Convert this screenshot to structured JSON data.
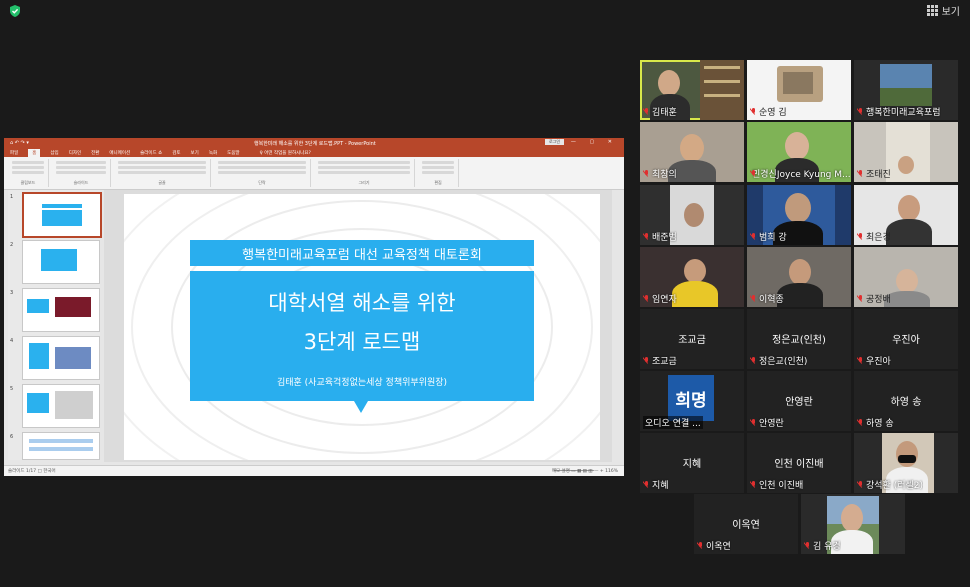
{
  "topbar": {
    "view_label": "보기",
    "security": "shield-icon"
  },
  "ppt": {
    "doc_title": "행복한미래 해소를 위한 3단계 로드맵.PPT - PowerPoint",
    "quick_access": "⌂ ↶ ↷ ▾",
    "signin": "로그인",
    "window_controls": "— ▢ ✕",
    "tabs": [
      "파일",
      "홈",
      "삽입",
      "디자인",
      "전환",
      "애니메이션",
      "슬라이드 쇼",
      "검토",
      "보기",
      "녹화",
      "도움말"
    ],
    "tell_me": "♀ 어떤 작업을 원하시나요?",
    "ribbon_groups": [
      "클립보드",
      "슬라이드",
      "글꼴",
      "단락",
      "그리기",
      "편집"
    ],
    "slide_numbers": [
      "1",
      "2",
      "3",
      "4",
      "5",
      "6"
    ],
    "status_left": "슬라이드 1/17   □   한국어",
    "status_right": "메모   설명   ▭ ▦ ▤ ▥  —  +  116%",
    "slide": {
      "banner_title": "행복한미래교육포럼 대선 교육정책 대토론회",
      "title_line1": "대학서열 해소를 위한",
      "title_line2": "3단계 로드맵",
      "author": "김태훈 (사교육걱정없는세상 정책위부위원장)"
    }
  },
  "participants": [
    {
      "name": "김태훈",
      "video": true,
      "active": true
    },
    {
      "name": "순영 김",
      "video": true
    },
    {
      "name": "행복한미래교육포럼",
      "video": true
    },
    {
      "name": "최창의",
      "video": true
    },
    {
      "name": "민경신Joyce Kyung M...",
      "video": true
    },
    {
      "name": "조태진",
      "video": true
    },
    {
      "name": "배준범",
      "video": true
    },
    {
      "name": "범희 강",
      "video": true
    },
    {
      "name": "최은경",
      "video": true
    },
    {
      "name": "임연자",
      "video": true
    },
    {
      "name": "이혁종",
      "video": true
    },
    {
      "name": "공정배",
      "video": true
    },
    {
      "name": "조교금",
      "video": false,
      "center": "조교금"
    },
    {
      "name": "정은교(인천)",
      "video": false,
      "center": "정은교(인천)"
    },
    {
      "name": "우진아",
      "video": false,
      "center": "우진아"
    },
    {
      "name": "오디오 연결 ...",
      "video": false,
      "avatar": "희명"
    },
    {
      "name": "안영란",
      "video": false,
      "center": "안영란"
    },
    {
      "name": "하영 송",
      "video": false,
      "center": "하영 송"
    },
    {
      "name": "지혜",
      "video": false,
      "center": "지혜"
    },
    {
      "name": "인천 이진배",
      "video": false,
      "center": "인천 이진배"
    },
    {
      "name": "강석환 (러셀2)",
      "video": true
    },
    {
      "name": "이옥연",
      "video": false,
      "center": "이옥연"
    },
    {
      "name": "김 유경",
      "video": true
    }
  ],
  "colors": {
    "ppt_accent": "#b7472a",
    "slide_blue": "#29aeee",
    "active_speaker": "#d8e84a",
    "muted_mic": "#e02f2f",
    "avatar_blue": "#1d5aa8"
  }
}
